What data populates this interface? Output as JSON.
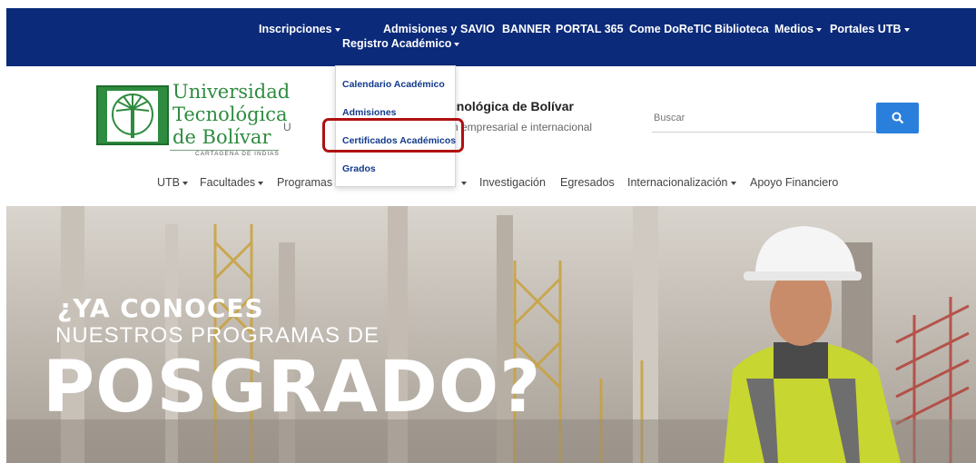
{
  "topnav": {
    "inscripciones": "Inscripciones",
    "admisiones_line1": "Admisiones y",
    "admisiones_line2": "Registro Académico",
    "savio": "SAVIO",
    "banner": "BANNER",
    "portal365": "PORTAL 365",
    "comedoretic": "Come DoReTIC",
    "biblioteca": "Biblioteca",
    "medios": "Medios",
    "portales": "Portales UTB"
  },
  "dropdown": {
    "items": [
      "Calendario Académico",
      "Admisiones",
      "Certificados Académicos",
      "Grados"
    ]
  },
  "logo": {
    "line1": "Universidad",
    "line2": "Tecnológica",
    "line3": "de Bolívar",
    "tagline": "CARTAGENA DE INDIAS"
  },
  "header": {
    "title": "cnológica de Bolívar",
    "subtitle": "n empresarial e internacional",
    "subtitle_left": "U"
  },
  "search": {
    "placeholder": "Buscar",
    "icon": "search-icon"
  },
  "secnav": {
    "utb": "UTB",
    "facultades": "Facultades",
    "programas": "Programas",
    "investigacion": "Investigación",
    "egresados": "Egresados",
    "internacionalizacion": "Internacionalización",
    "apoyo": "Apoyo Financiero"
  },
  "hero": {
    "line1": "¿YA CONOCES",
    "line2": "NUESTROS PROGRAMAS DE",
    "line3": "POSGRADO?"
  },
  "colors": {
    "topnav_bg": "#0b2a7a",
    "logo_green": "#2e8b3f",
    "search_button": "#2a7fdc",
    "highlight": "#b01010"
  }
}
